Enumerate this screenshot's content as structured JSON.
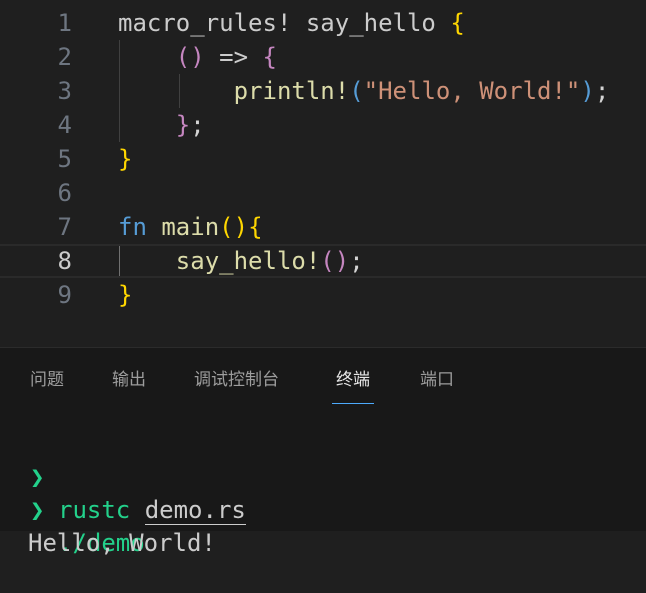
{
  "editor": {
    "line_numbers": [
      "1",
      "2",
      "3",
      "4",
      "5",
      "6",
      "7",
      "8",
      "9"
    ],
    "active_line": "8",
    "lines": [
      [
        {
          "t": "macro_rules! say_hello ",
          "c": "white"
        },
        {
          "t": "{",
          "c": "yellow"
        }
      ],
      [
        {
          "t": "    ",
          "c": "white"
        },
        {
          "t": "()",
          "c": "purple"
        },
        {
          "t": " => ",
          "c": "white"
        },
        {
          "t": "{",
          "c": "purple"
        }
      ],
      [
        {
          "t": "        ",
          "c": "white"
        },
        {
          "t": "println!",
          "c": "ltyellow"
        },
        {
          "t": "(",
          "c": "blue"
        },
        {
          "t": "\"Hello, World!\"",
          "c": "string"
        },
        {
          "t": ")",
          "c": "blue"
        },
        {
          "t": ";",
          "c": "punct"
        }
      ],
      [
        {
          "t": "    ",
          "c": "white"
        },
        {
          "t": "}",
          "c": "purple"
        },
        {
          "t": ";",
          "c": "punct"
        }
      ],
      [
        {
          "t": "}",
          "c": "yellow"
        }
      ],
      [],
      [
        {
          "t": "fn",
          "c": "blue"
        },
        {
          "t": " main",
          "c": "ltyellow"
        },
        {
          "t": "()",
          "c": "yellow"
        },
        {
          "t": "{",
          "c": "yellow"
        }
      ],
      [
        {
          "t": "    say_hello!",
          "c": "ltyellow"
        },
        {
          "t": "()",
          "c": "purple"
        },
        {
          "t": ";",
          "c": "punct"
        }
      ],
      [
        {
          "t": "}",
          "c": "yellow"
        }
      ]
    ]
  },
  "panel": {
    "tabs": [
      {
        "label": "问题",
        "active": false
      },
      {
        "label": "输出",
        "active": false
      },
      {
        "label": "调试控制台",
        "active": false
      },
      {
        "label": "终端",
        "active": true
      },
      {
        "label": "端口",
        "active": false
      }
    ]
  },
  "terminal": {
    "prompt_symbol": "❯",
    "line1_cmd": "rustc",
    "line1_arg": "demo.rs",
    "line2_cmd": "./demo",
    "output": "Hello, World!"
  },
  "colors": {
    "background": "#1f1f1f",
    "panel_background": "#181818",
    "terminal_green": "#23d18b",
    "tab_active_underline": "#4daafc"
  }
}
